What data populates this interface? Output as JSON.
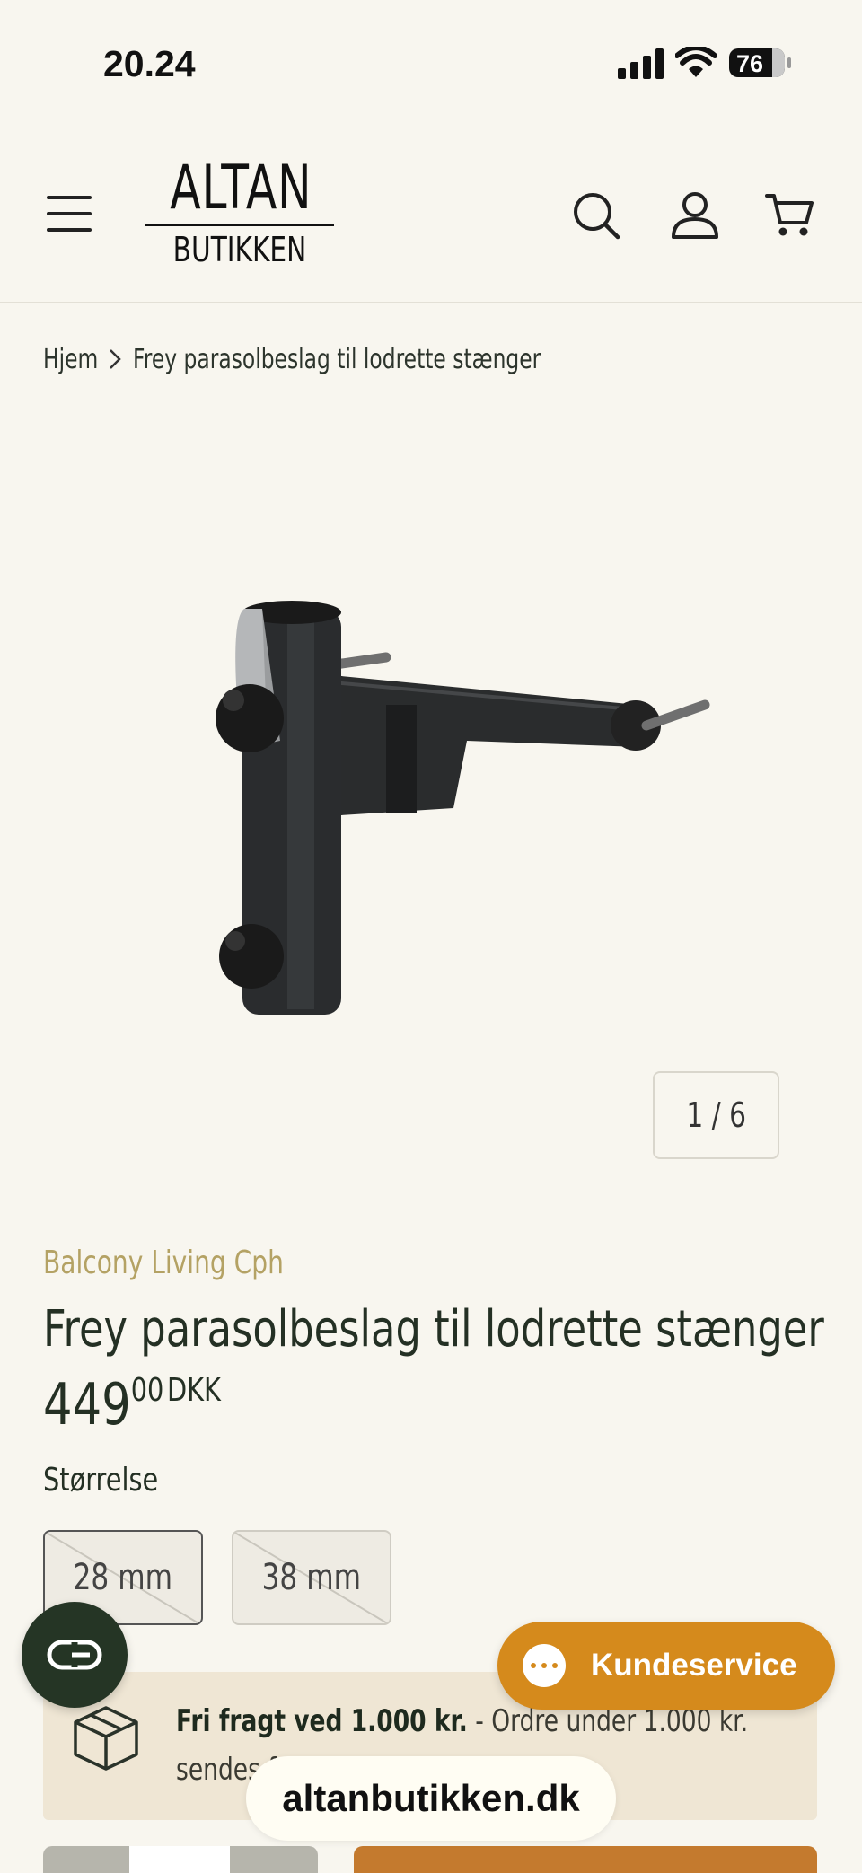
{
  "status_bar": {
    "time": "20.24",
    "battery": "76"
  },
  "header": {
    "logo_top": "ALTAN",
    "logo_bottom": "BUTIKKEN",
    "icons": [
      "menu-icon",
      "search-icon",
      "account-icon",
      "cart-icon"
    ]
  },
  "breadcrumb": {
    "home": "Hjem",
    "current": "Frey parasolbeslag til lodrette stænger"
  },
  "gallery": {
    "counter": "1 / 6"
  },
  "product": {
    "vendor": "Balcony Living Cph",
    "title": "Frey parasolbeslag til lodrette stænger",
    "price_main": "449",
    "price_decimals": "00",
    "currency": "DKK",
    "option_label": "Størrelse",
    "options": [
      {
        "label": "28 mm",
        "selected": true,
        "available": false
      },
      {
        "label": "38 mm",
        "selected": false,
        "available": false
      }
    ]
  },
  "shipping": {
    "bold": "Fri fragt ved 1.000 kr.",
    "rest": " - Ordre under 1.000 kr. sendes for 49 kr."
  },
  "support_button": {
    "label": "Kundeservice"
  },
  "url_bar": {
    "domain": "altanbutikken.dk"
  },
  "colors": {
    "background": "#f8f6ef",
    "vendor": "#b4a264",
    "title": "#243024",
    "support": "#d58a1c",
    "chat_fab": "#253525",
    "shipping_bg": "#efe6d4"
  }
}
